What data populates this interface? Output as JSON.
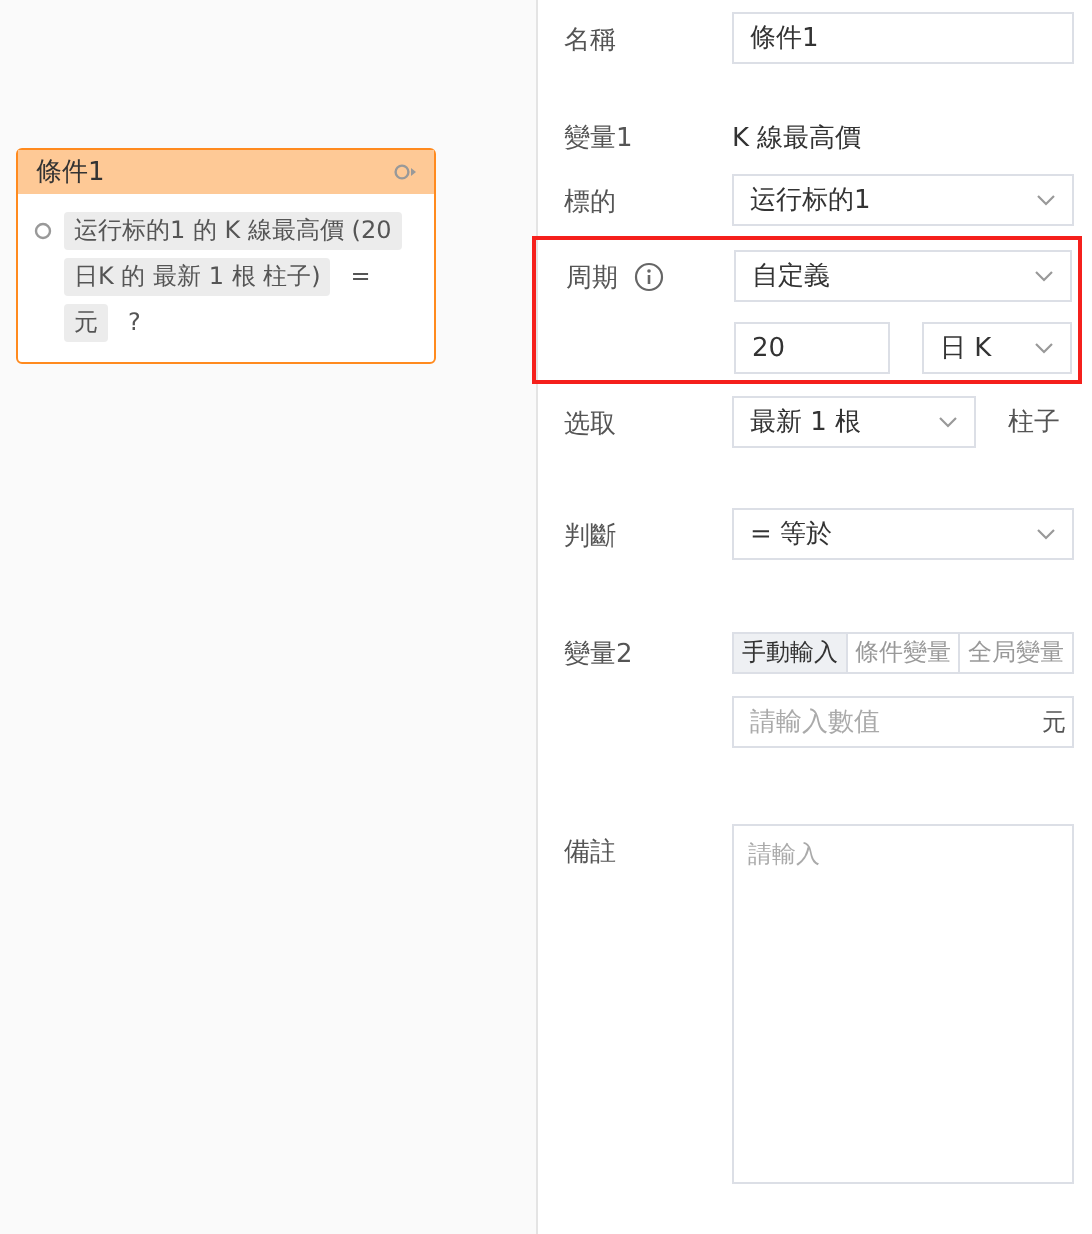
{
  "node": {
    "title": "條件1",
    "tokens": [
      {
        "kind": "chip",
        "text": "运行标的1 的 K 線最高價 (20"
      },
      {
        "kind": "chip",
        "text": "日K 的 最新 1 根 柱子)"
      },
      {
        "kind": "plain",
        "text": "="
      },
      {
        "kind": "chip",
        "text": "元"
      },
      {
        "kind": "plain",
        "text": "?"
      }
    ]
  },
  "form": [
    {
      "kind": "input",
      "label": "名稱",
      "value": "條件1"
    },
    {
      "kind": "static",
      "label": "變量1",
      "value": "K 線最高價"
    },
    {
      "kind": "select",
      "label": "標的",
      "value": "运行标的1"
    },
    {
      "kind": "period",
      "label": "周期",
      "info": true,
      "highlighted": true,
      "value": "自定義",
      "count": "20",
      "unit": "日 K"
    },
    {
      "kind": "select_suffix",
      "label": "选取",
      "value": "最新 1 根",
      "suffix": "柱子"
    },
    {
      "kind": "select",
      "label": "判斷",
      "value": "= 等於"
    },
    {
      "kind": "variable",
      "label": "變量2",
      "options": [
        {
          "label": "手動輸入",
          "selected": true
        },
        {
          "label": "條件變量",
          "selected": false
        },
        {
          "label": "全局變量",
          "selected": false
        }
      ],
      "placeholder": "請輸入數值",
      "suffix": "元"
    },
    {
      "kind": "textarea",
      "label": "備註",
      "placeholder": "請輸入"
    }
  ]
}
